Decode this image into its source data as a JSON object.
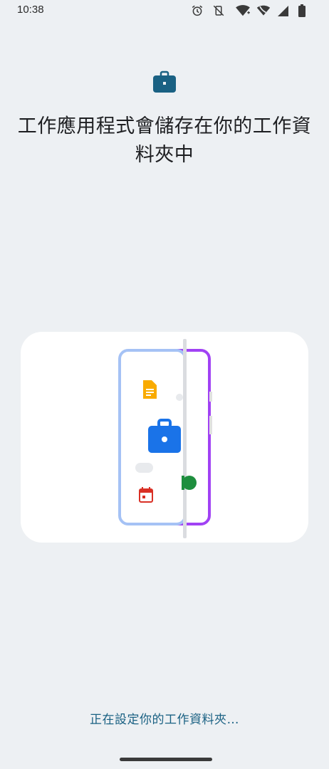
{
  "status_bar": {
    "time": "10:38",
    "icons": [
      "alarm-icon",
      "vibrate-off-icon",
      "wifi-icon",
      "phone-wifi-icon",
      "signal-icon",
      "battery-icon"
    ]
  },
  "header": {
    "icon": "briefcase-icon",
    "title": "工作應用程式會儲存在你的工作資料夾中"
  },
  "illustration": {
    "icons": [
      "docs-icon",
      "work-briefcase-icon",
      "calendar-icon",
      "green-app-icon"
    ]
  },
  "footer": {
    "status": "正在設定你的工作資料夾…"
  },
  "colors": {
    "background": "#edf0f3",
    "accent": "#1a6183",
    "personal_frame": "#a5c2f5",
    "work_frame": "#a142f4",
    "briefcase": "#1a73e8"
  }
}
